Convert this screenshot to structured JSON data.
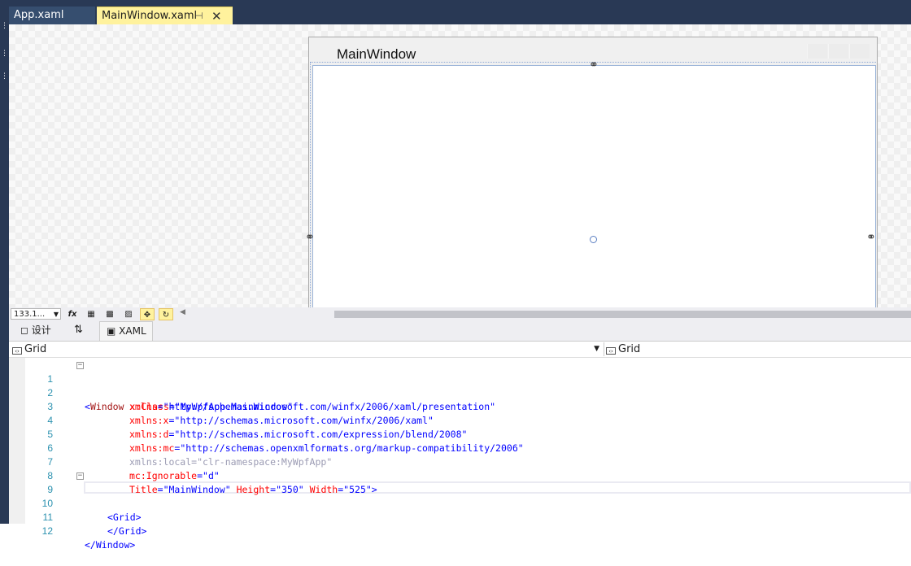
{
  "tabs": [
    {
      "label": "App.xaml"
    },
    {
      "label": "MainWindow.xaml",
      "pin_icon": "pin-icon",
      "close_icon": "close-icon"
    }
  ],
  "designer": {
    "window_title": "MainWindow"
  },
  "zoom": {
    "value": "133.1..."
  },
  "toolbar_icons": [
    "fx-icon",
    "grid-icon",
    "snap-grid-icon",
    "checker-icon",
    "snap-lines-icon",
    "refresh-icon"
  ],
  "split_tabs": {
    "design": "设计",
    "swap": "⇅",
    "xaml": "XAML"
  },
  "selector": {
    "left": "Grid",
    "right": "Grid"
  },
  "code": {
    "line_numbers": [
      "1",
      "2",
      "3",
      "4",
      "5",
      "6",
      "7",
      "8",
      "9",
      "10",
      "11",
      "12"
    ],
    "line1": {
      "open": "<",
      "tag": "Window",
      "attr": " x:Class",
      "eq": "=",
      "val": "\"MyWpfApp.MainWindow\""
    },
    "line2": {
      "attr": "xmlns",
      "eq": "=",
      "val": "\"http://schemas.microsoft.com/winfx/2006/xaml/presentation\""
    },
    "line3": {
      "attr": "xmlns:x",
      "eq": "=",
      "val": "\"http://schemas.microsoft.com/winfx/2006/xaml\""
    },
    "line4": {
      "attr": "xmlns:d",
      "eq": "=",
      "val": "\"http://schemas.microsoft.com/expression/blend/2008\""
    },
    "line5": {
      "attr": "xmlns:mc",
      "eq": "=",
      "val": "\"http://schemas.openxmlformats.org/markup-compatibility/2006\""
    },
    "line6": {
      "text": "xmlns:local=\"clr-namespace:MyWpfApp\""
    },
    "line7": {
      "attr": "mc:Ignorable",
      "eq": "=",
      "val": "\"d\""
    },
    "line8": {
      "a1": "Title",
      "v1": "\"MainWindow\"",
      "a2": " Height",
      "v2": "\"350\"",
      "a3": " Width",
      "v3": "\"525\"",
      "close": ">"
    },
    "line9": {
      "text": "<Grid>"
    },
    "line11": {
      "text": "</Grid>"
    },
    "line12": {
      "text": "</Window>"
    }
  },
  "colors": {
    "tab_active_bg": "#fff29d",
    "chrome_dark": "#293955",
    "xml_tag": "#0000ff",
    "xml_attr": "#ff0000",
    "line_number": "#2b91af"
  }
}
